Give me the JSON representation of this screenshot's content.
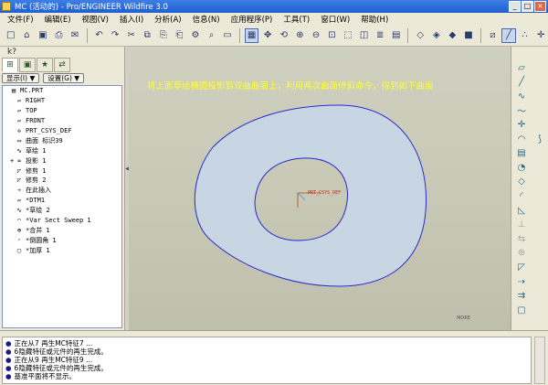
{
  "window": {
    "title": "MC (活动的) - Pro/ENGINEER Wildfire 3.0",
    "buttons": [
      "_",
      "□",
      "×"
    ]
  },
  "menu": [
    "文件(F)",
    "编辑(E)",
    "视图(V)",
    "插入(I)",
    "分析(A)",
    "信息(N)",
    "应用程序(P)",
    "工具(T)",
    "窗口(W)",
    "帮助(H)"
  ],
  "toolbar_icons": [
    "new-icon",
    "open-icon",
    "save-icon",
    "print-icon",
    "email-icon",
    "sep",
    "undo-icon",
    "redo-icon",
    "cut-icon",
    "copy-icon",
    "paste-icon",
    "paste-special-icon",
    "regenerate-icon",
    "find-icon",
    "select-box-icon",
    "sep",
    "repaint-icon",
    "spin-center-icon",
    "orient-icon",
    "zoom-in-icon",
    "zoom-out-icon",
    "refit-icon",
    "reorient-icon",
    "saved-views-icon",
    "layers-icon",
    "view-manager-icon",
    "sep",
    "wireframe-icon",
    "hidden-line-icon",
    "no-hidden-icon",
    "shading-icon",
    "sep",
    "datum-planes-icon",
    "datum-axes-icon",
    "datum-points-icon",
    "coord-sys-icon"
  ],
  "nav": {
    "help_glyph": "k?",
    "tabs": [
      "model-tree-tab",
      "folder-tab",
      "favorites-tab",
      "connections-tab"
    ],
    "display_button": "显示(I) ▼",
    "settings_button": "设置(G) ▼"
  },
  "tree": [
    {
      "text": "MC.PRT",
      "icon": "part-icon",
      "indent": 0,
      "expand": ""
    },
    {
      "text": "RIGHT",
      "icon": "datum-plane-icon",
      "indent": 1,
      "expand": ""
    },
    {
      "text": "TOP",
      "icon": "datum-plane-icon",
      "indent": 1,
      "expand": ""
    },
    {
      "text": "FRONT",
      "icon": "datum-plane-icon",
      "indent": 1,
      "expand": ""
    },
    {
      "text": "PRT_CSYS_DEF",
      "icon": "csys-icon",
      "indent": 1,
      "expand": ""
    },
    {
      "text": "曲面 标识39",
      "icon": "surface-icon",
      "indent": 1,
      "expand": ""
    },
    {
      "text": "草绘 1",
      "icon": "sketch-icon",
      "indent": 1,
      "expand": ""
    },
    {
      "text": "投影 1",
      "icon": "projection-icon",
      "indent": 1,
      "expand": "+"
    },
    {
      "text": "修剪 1",
      "icon": "trim-icon",
      "indent": 1,
      "expand": ""
    },
    {
      "text": "修剪 2",
      "icon": "trim-icon",
      "indent": 1,
      "expand": ""
    },
    {
      "text": "在此插入",
      "icon": "insert-here-icon",
      "indent": 1,
      "expand": ""
    },
    {
      "text": "*DTM1",
      "icon": "datum-plane-icon",
      "indent": 1,
      "expand": ""
    },
    {
      "text": "*草绘 2",
      "icon": "sketch-icon",
      "indent": 1,
      "expand": ""
    },
    {
      "text": "*Var Sect Sweep 1",
      "icon": "sweep-icon",
      "indent": 1,
      "expand": ""
    },
    {
      "text": "*合并 1",
      "icon": "merge-icon",
      "indent": 1,
      "expand": ""
    },
    {
      "text": "*倒圆角 1",
      "icon": "round-icon",
      "indent": 1,
      "expand": ""
    },
    {
      "text": "*加厚 1",
      "icon": "thicken-icon",
      "indent": 1,
      "expand": ""
    }
  ],
  "viewport": {
    "annotation": "将上面草绘椭圆投影到双曲曲面上，利用两次曲面修剪命令，得到如下曲面",
    "csys_label": "PRT_CSYS_DEF",
    "watermark": "MORE",
    "surface_fill": "#c8d6e4",
    "edge_color": "#2a2ad0",
    "text_color": "#ffff33"
  },
  "right_toolbar": [
    [
      "datum-plane-tool-icon",
      ""
    ],
    [
      "datum-axis-tool-icon",
      ""
    ],
    [
      "sketch-tool-icon",
      ""
    ],
    [
      "datum-curve-tool-icon",
      ""
    ],
    [
      "csys-tool-icon",
      ""
    ],
    [
      "sweep-tool-icon",
      "analysis-icon"
    ],
    [
      "extrude-tool-icon",
      ""
    ],
    [
      "revolve-tool-icon",
      ""
    ],
    [
      "blend-tool-icon",
      ""
    ],
    [
      "round-tool-icon",
      ""
    ],
    [
      "chamfer-tool-icon",
      ""
    ],
    [
      "rib-tool-icon",
      ""
    ],
    [
      "mirror-tool-icon",
      ""
    ],
    [
      "merge-tool-icon",
      ""
    ],
    [
      "trim-tool-icon",
      ""
    ],
    [
      "extend-tool-icon",
      ""
    ],
    [
      "offset-tool-icon",
      ""
    ],
    [
      "thicken-tool-icon",
      ""
    ]
  ],
  "messages": [
    "正在从7 再生MC特征7 ...",
    "6隐藏特征或元件的再生完成。",
    "正在从9 再生MC特征9 ...",
    "6隐藏特征或元件的再生完成。",
    "基准平面将不显示。"
  ]
}
